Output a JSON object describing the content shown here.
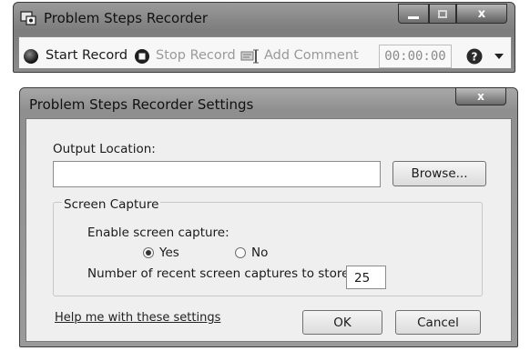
{
  "recorder": {
    "title": "Problem Steps Recorder",
    "start_label": "Start Record",
    "stop_label": "Stop Record",
    "comment_label": "Add Comment",
    "timer": "00:00:00",
    "help_icon": "help-icon",
    "dropdown_icon": "chevron-down-icon"
  },
  "window_buttons": {
    "minimize": "‒",
    "maximize": "□",
    "close": "x"
  },
  "settings": {
    "title": "Problem Steps Recorder Settings",
    "close_glyph": "x",
    "output_location_label": "Output Location:",
    "output_location_value": "",
    "browse_label": "Browse...",
    "screen_capture_group": "Screen Capture",
    "enable_capture_label": "Enable screen capture:",
    "yes_label": "Yes",
    "no_label": "No",
    "selected": "Yes",
    "captures_label": "Number of recent screen captures to store:",
    "captures_value": "25",
    "help_link": "Help me with these settings",
    "ok_label": "OK",
    "cancel_label": "Cancel"
  },
  "colors": {
    "title_bar": "#8a8a8a",
    "dialog_bg": "#efefef",
    "disabled_text": "#9a9a9a"
  }
}
